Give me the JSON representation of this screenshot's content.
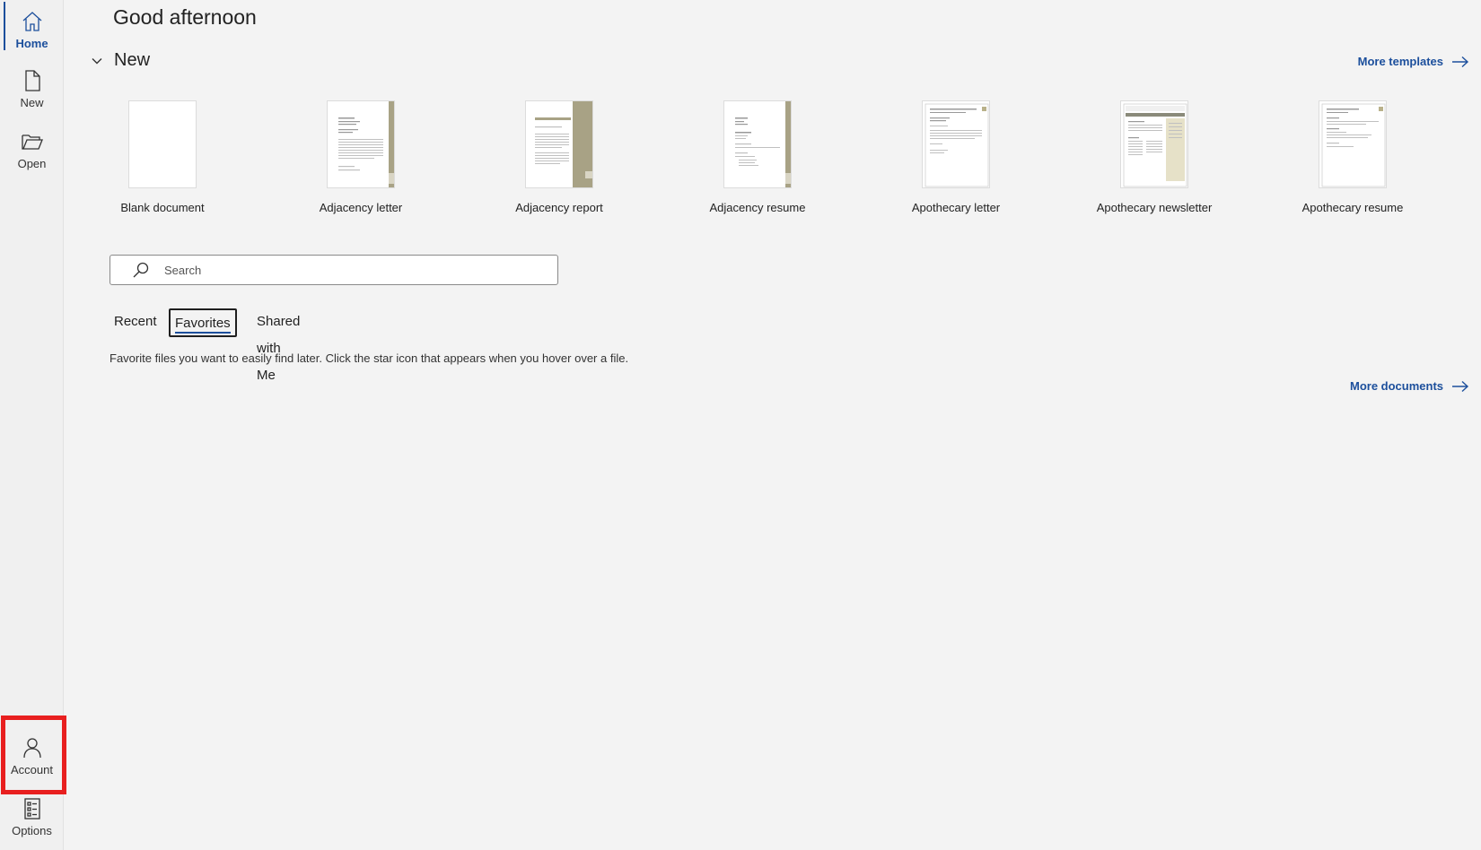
{
  "sidebar": {
    "items": [
      {
        "label": "Home",
        "icon": "home-icon"
      },
      {
        "label": "New",
        "icon": "new-document-icon"
      },
      {
        "label": "Open",
        "icon": "folder-open-icon"
      }
    ],
    "bottom_items": [
      {
        "label": "Account",
        "icon": "person-icon"
      },
      {
        "label": "Options",
        "icon": "options-icon"
      }
    ],
    "active": "Home"
  },
  "main": {
    "greeting": "Good afternoon",
    "new_section": {
      "title": "New",
      "more_templates": "More templates",
      "templates": [
        {
          "name": "Blank document",
          "style": "blank"
        },
        {
          "name": "Adjacency letter",
          "style": "adjacency-letter"
        },
        {
          "name": "Adjacency report",
          "style": "adjacency-report"
        },
        {
          "name": "Adjacency resume",
          "style": "adjacency-resume"
        },
        {
          "name": "Apothecary letter",
          "style": "apothecary-letter"
        },
        {
          "name": "Apothecary newsletter",
          "style": "apothecary-newsletter"
        },
        {
          "name": "Apothecary resume",
          "style": "apothecary-resume"
        }
      ]
    },
    "search": {
      "placeholder": "Search",
      "value": ""
    },
    "tabs": [
      {
        "label": "Recent",
        "active": false
      },
      {
        "label": "Favorites",
        "active": true
      },
      {
        "label": "Shared with Me",
        "active": false
      }
    ],
    "favorites_message": "Favorite files you want to easily find later. Click the star icon that appears when you hover over a file.",
    "more_documents": "More documents"
  },
  "colors": {
    "accent": "#1c4f9c",
    "background": "#f3f3f3",
    "highlight": "#e81f1f",
    "template_sidebar": "#a8a285"
  }
}
